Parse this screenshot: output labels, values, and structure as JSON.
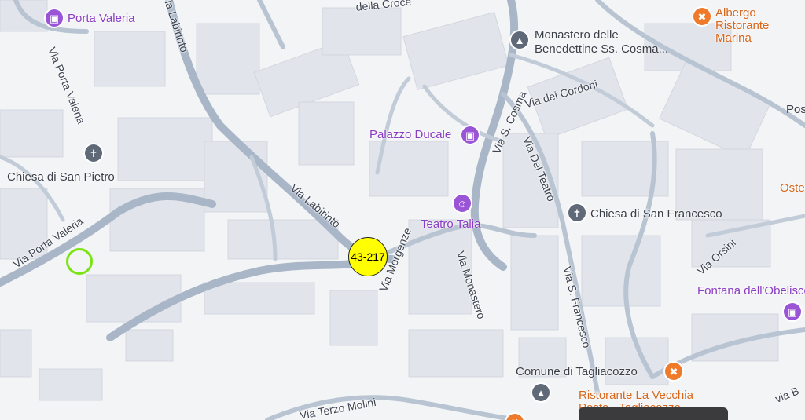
{
  "streets": {
    "via_porta_valeria_top": "Via Porta Valeria",
    "via_porta_valeria_left": "Via Porta Valeria",
    "via_labirinto_top": "Via Labirinto",
    "via_labirinto_mid": "Via Labirinto",
    "via_della_croce": "della Croce",
    "via_dei_cordoni": "Via dei Cordoni",
    "via_s_cosma": "Via S. Cosma",
    "via_del_teatro": "Via Del Teatro",
    "via_monastero": "Via Monastero",
    "via_s_francesco": "Via S. Francesco",
    "via_orsini": "Via Orsini",
    "via_terzo_molini": "Via Terzo Molini",
    "via_morgenze": "Via Morgenze",
    "via_b": "via B"
  },
  "pois": {
    "porta_valeria": "Porta Valeria",
    "monastero": "Monastero delle Benedettine Ss. Cosma...",
    "palazzo_ducale": "Palazzo Ducale",
    "teatro_talia": "Teatro Talia",
    "chiesa_san_pietro": "Chiesa di San Pietro",
    "chiesa_san_francesco": "Chiesa di San Francesco",
    "fontana": "Fontana dell'Obelisco",
    "comune": "Comune di Tagliacozzo",
    "ristorante_vecchia": "Ristorante La Vecchia Posta - Tagliacozzo",
    "albergo": "Albergo Ristorante Marina",
    "oste": "Oste",
    "pos": "Pos"
  },
  "marker": {
    "label": "43-217",
    "color": "#ffff00"
  },
  "colors": {
    "poi": "#8a3cc2",
    "food": "#d8661a",
    "road": "#a9b6c7",
    "building": "#e1e4ea",
    "ring": "#7be414"
  },
  "icons": {
    "camera": "camera-icon",
    "cross": "church-icon",
    "fork": "restaurant-icon",
    "museum": "landmark-icon",
    "theater": "theater-icon"
  }
}
